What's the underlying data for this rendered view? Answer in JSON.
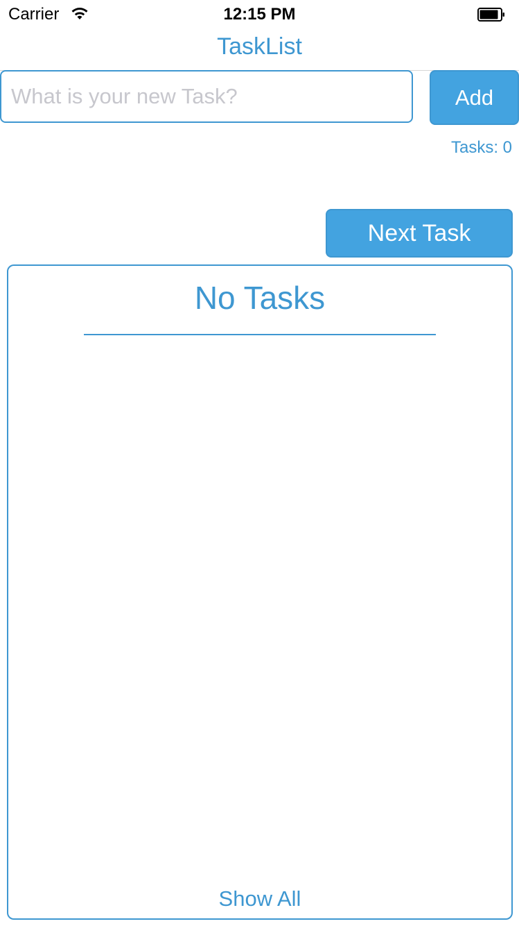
{
  "status_bar": {
    "carrier": "Carrier",
    "time": "12:15 PM",
    "wifi_icon": "wifi-icon",
    "battery_icon": "battery-icon"
  },
  "nav": {
    "title": "TaskList"
  },
  "task_input": {
    "value": "",
    "placeholder": "What is your new Task?"
  },
  "add_button": {
    "label": "Add"
  },
  "task_count": "Tasks: 0",
  "next_button": {
    "label": "Next Task"
  },
  "panel": {
    "title": "No Tasks",
    "show_all_label": "Show All"
  },
  "colors": {
    "accent": "#3e97d1",
    "button_fill": "#43a3e0",
    "placeholder": "#c7c7cd"
  }
}
